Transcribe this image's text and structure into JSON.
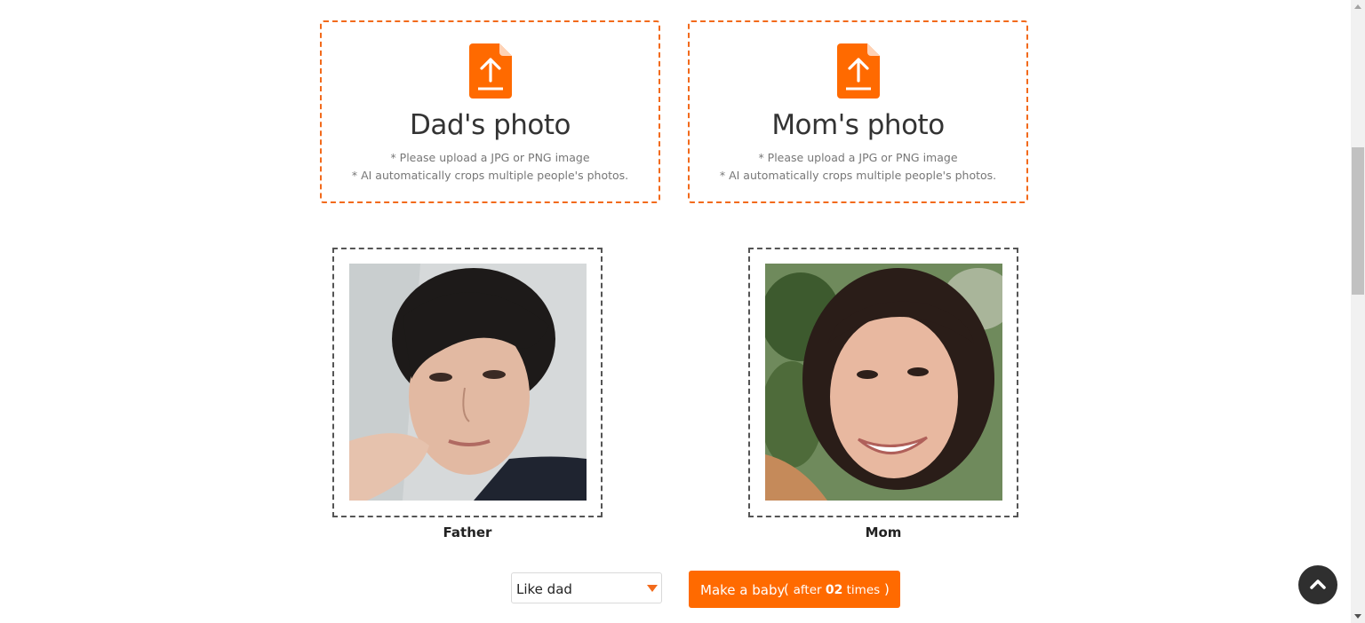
{
  "upload": {
    "dad": {
      "title": "Dad's photo",
      "note1": "* Please upload a JPG or PNG image",
      "note2": "* AI automatically crops multiple people's photos."
    },
    "mom": {
      "title": "Mom's photo",
      "note1": "* Please upload a JPG or PNG image",
      "note2": "* AI automatically crops multiple people's photos."
    },
    "icon": "file-upload-icon"
  },
  "photos": {
    "father_caption": "Father",
    "mother_caption": "Mom"
  },
  "controls": {
    "likeness_selected": "Like dad",
    "make_label": "Make a baby",
    "after_label": "after",
    "times_count": "02",
    "times_label": "times"
  },
  "colors": {
    "accent": "#ff6a00",
    "dashed_border_upload": "#f26a1b",
    "dashed_border_photo": "#555555"
  },
  "floating": {
    "back_to_top_icon": "chevron-up-icon"
  }
}
